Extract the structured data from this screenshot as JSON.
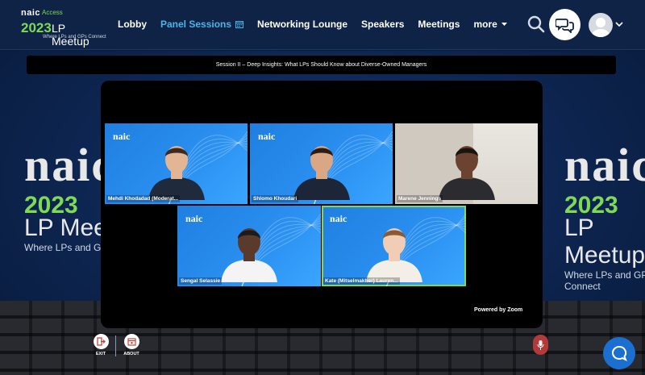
{
  "header": {
    "logo": {
      "brand": "naic",
      "brand_sub": "Access",
      "year": "2023",
      "event": "LP Meetup",
      "tagline": "Where LPs and GPs Connect"
    },
    "nav": [
      {
        "label": "Lobby",
        "active": false
      },
      {
        "label": "Panel Sessions",
        "active": true,
        "icon": "calendar-icon"
      },
      {
        "label": "Networking Lounge",
        "active": false
      },
      {
        "label": "Speakers",
        "active": false
      },
      {
        "label": "Meetings",
        "active": false
      },
      {
        "label": "more",
        "active": false,
        "icon": "caret-down-icon"
      }
    ],
    "icons": {
      "search": "search-icon",
      "chat": "chat-bubbles-icon",
      "avatar": "user-avatar",
      "menu": "chevron-down-icon"
    }
  },
  "backdrop": {
    "brand": "naic",
    "year": "2023",
    "event": "LP Meetup",
    "tagline": "Where LPs and GPs Connect"
  },
  "session": {
    "title": "Session II – Deep Insights: What LPs Should Know about Diverse-Owned Managers"
  },
  "zoom": {
    "tile_logo": "naic",
    "participants": [
      {
        "name": "Mehdi Khodadad (Moderat...",
        "background": "blue",
        "active": false
      },
      {
        "name": "Shlomo Khoudari",
        "background": "blue",
        "active": false
      },
      {
        "name": "Marene Jennings",
        "background": "room",
        "active": false
      },
      {
        "name": "Sengal Selassie",
        "background": "blue",
        "active": false
      },
      {
        "name": "Kate (Mitselmakher) Lauren...",
        "background": "blue",
        "active": true
      }
    ],
    "powered_by": "Powered by Zoom"
  },
  "controls": {
    "exit": "EXIT",
    "about": "ABOUT"
  },
  "colors": {
    "nav_bg": "#0f2346",
    "active_nav": "#4fb3e6",
    "brand_green": "#7ed957",
    "tile_blue": "#1f7fe0",
    "speaker_highlight": "#7ed957",
    "help_button": "#1b6fd1"
  }
}
